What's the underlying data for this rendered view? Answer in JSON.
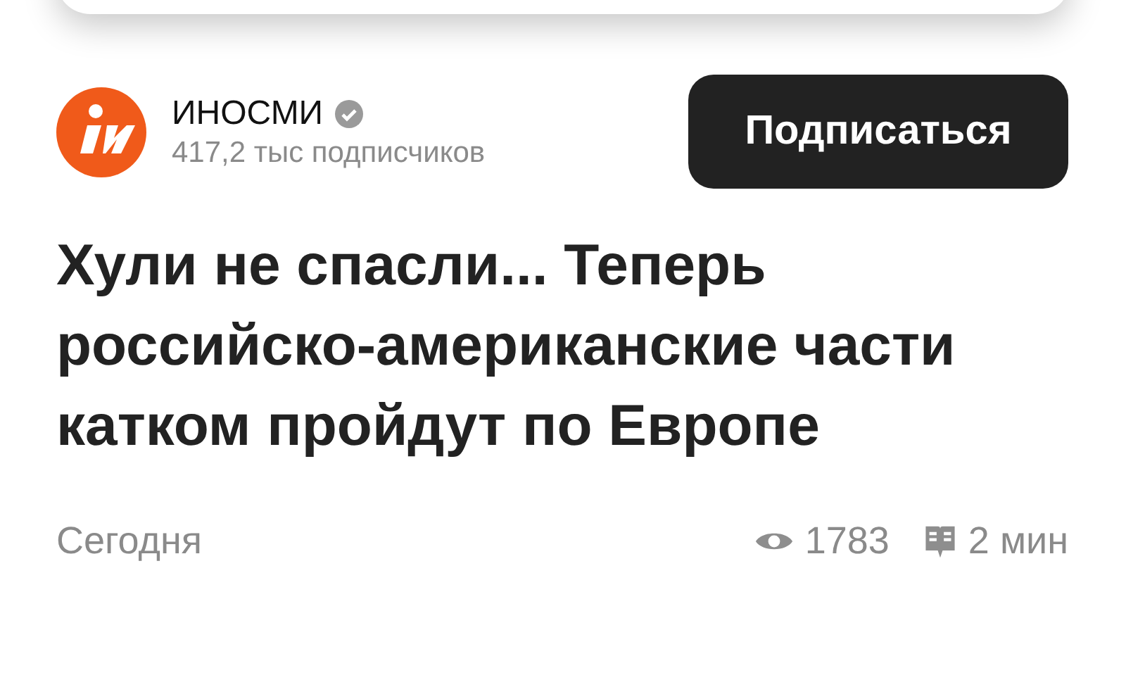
{
  "channel": {
    "name": "ИНОСМИ",
    "verified": true,
    "subscribers": "417,2 тыс подписчиков"
  },
  "subscribe_button": "Подписаться",
  "headline": "Хули не спасли... Теперь российско-американские части катком пройдут по Европе",
  "footer": {
    "date": "Сегодня",
    "views": "1783",
    "read_time": "2 мин"
  }
}
